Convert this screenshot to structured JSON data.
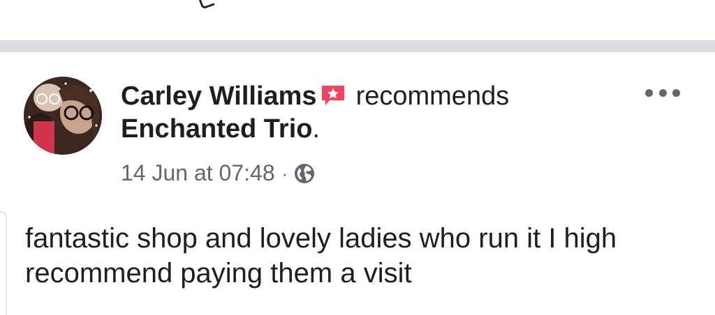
{
  "post": {
    "author_name": "Carley Williams",
    "action_text": "recommends",
    "page_name": "Enchanted Trio",
    "page_name_suffix": ".",
    "timestamp": "14 Jun at 07:48",
    "separator": "·",
    "privacy_icon": "globe-icon",
    "recommendation_icon": "recommendation-star-icon",
    "more_icon": "more-options-icon",
    "body": "fantastic shop and lovely ladies who run it I high recommend paying them a visit"
  },
  "colors": {
    "text_primary": "#1c1e21",
    "text_secondary": "#606770",
    "recommend_badge": "#f3425f",
    "separator": "#dadde1"
  }
}
